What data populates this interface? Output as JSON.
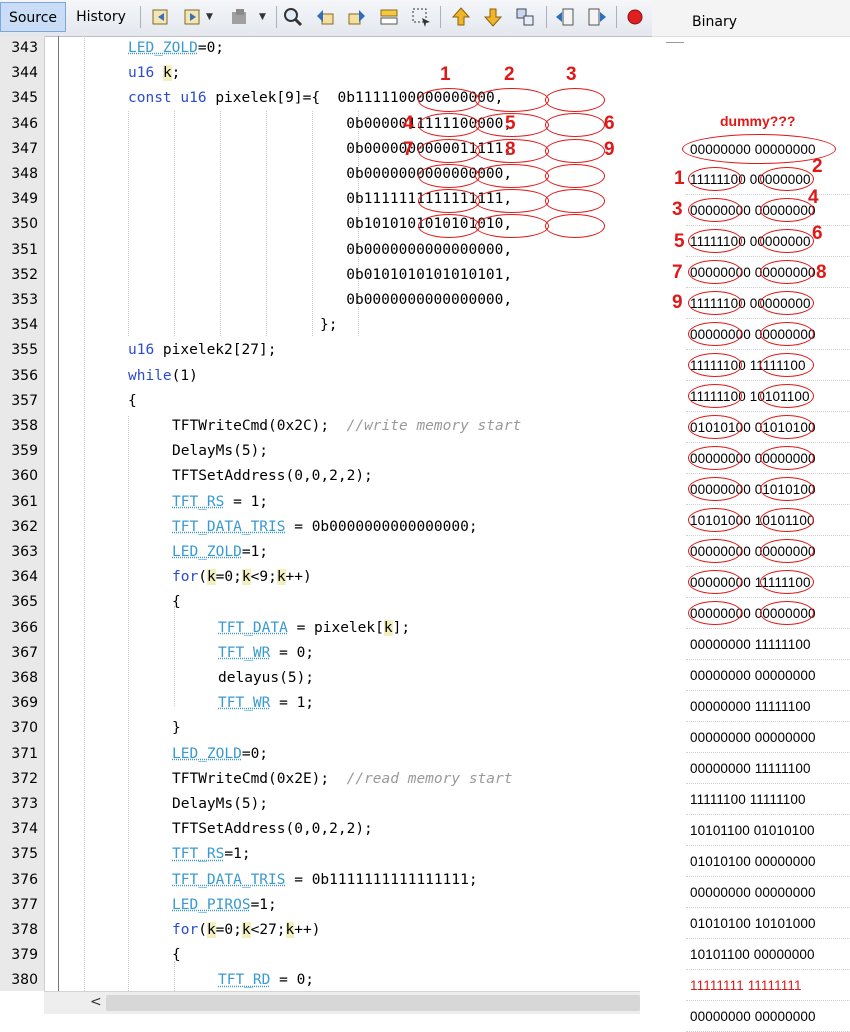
{
  "toolbar": {
    "tab_source": "Source",
    "tab_history": "History",
    "icons": [
      "back-icon",
      "forward-icon",
      "history-icon",
      "search-icon",
      "prev-occurrence-icon",
      "next-occurrence-icon",
      "toggle-highlight-icon",
      "select-icon",
      "bookmark-prev-icon",
      "bookmark-next-icon",
      "toggle-bookmark-icon",
      "shift-left-icon",
      "shift-right-icon",
      "record-macro-icon"
    ],
    "record_color": "#e02020"
  },
  "editor": {
    "lines": [
      {
        "num": "343",
        "text": "LED_ZOLD=0;"
      },
      {
        "num": "344",
        "text": "u16 k;"
      },
      {
        "num": "345",
        "text": "const u16 pixelek[9]={  0b1111100000000000,"
      },
      {
        "num": "346",
        "text": "                         0b0000011111100000,"
      },
      {
        "num": "347",
        "text": "                         0b0000000000011111,"
      },
      {
        "num": "348",
        "text": "                         0b0000000000000000,"
      },
      {
        "num": "349",
        "text": "                         0b1111111111111111,"
      },
      {
        "num": "350",
        "text": "                         0b1010101010101010,"
      },
      {
        "num": "351",
        "text": "                         0b0000000000000000,"
      },
      {
        "num": "352",
        "text": "                         0b0101010101010101,"
      },
      {
        "num": "353",
        "text": "                         0b0000000000000000,"
      },
      {
        "num": "354",
        "text": "                      };"
      },
      {
        "num": "355",
        "text": "u16 pixelek2[27];"
      },
      {
        "num": "356",
        "text": "while(1)"
      },
      {
        "num": "357",
        "text": "{"
      },
      {
        "num": "358",
        "text": "TFTWriteCmd(0x2C);  //write memory start"
      },
      {
        "num": "359",
        "text": "DelayMs(5);"
      },
      {
        "num": "360",
        "text": "TFTSetAddress(0,0,2,2);"
      },
      {
        "num": "361",
        "text": "TFT_RS = 1;"
      },
      {
        "num": "362",
        "text": "TFT_DATA_TRIS = 0b0000000000000000;"
      },
      {
        "num": "363",
        "text": "LED_ZOLD=1;"
      },
      {
        "num": "364",
        "text": "for(k=0;k<9;k++)"
      },
      {
        "num": "365",
        "text": "{"
      },
      {
        "num": "366",
        "text": "TFT_DATA = pixelek[k];"
      },
      {
        "num": "367",
        "text": "TFT_WR = 0;"
      },
      {
        "num": "368",
        "text": "delayus(5);"
      },
      {
        "num": "369",
        "text": "TFT_WR = 1;"
      },
      {
        "num": "370",
        "text": "}"
      },
      {
        "num": "371",
        "text": "LED_ZOLD=0;"
      },
      {
        "num": "372",
        "text": "TFTWriteCmd(0x2E);  //read memory start"
      },
      {
        "num": "373",
        "text": "DelayMs(5);"
      },
      {
        "num": "374",
        "text": "TFTSetAddress(0,0,2,2);"
      },
      {
        "num": "375",
        "text": "TFT_RS=1;"
      },
      {
        "num": "376",
        "text": "TFT_DATA_TRIS = 0b1111111111111111;"
      },
      {
        "num": "377",
        "text": "LED_PIROS=1;"
      },
      {
        "num": "378",
        "text": "for(k=0;k<27;k++)"
      },
      {
        "num": "379",
        "text": "{"
      },
      {
        "num": "380",
        "text": "TFT_RD = 0;"
      }
    ]
  },
  "binary_panel": {
    "header": "Binary",
    "dummy_label": "dummy???",
    "dummy_value": "00000000 00000000",
    "rows": [
      "11111100 00000000",
      "00000000 00000000",
      "11111100 00000000",
      "00000000 00000000",
      "11111100 00000000",
      "00000000 00000000",
      "11111100 11111100",
      "11111100 10101100",
      "01010100 01010100",
      "00000000 00000000",
      "00000000 01010100",
      "10101000 10101100",
      "00000000 00000000",
      "00000000 11111100",
      "00000000 00000000",
      "00000000 11111100",
      "00000000 00000000",
      "00000000 11111100",
      "00000000 00000000",
      "00000000 11111100",
      "11111100 11111100",
      "10101100 01010100",
      "01010100 00000000",
      "00000000 00000000",
      "01010100 10101000",
      "10101100 00000000",
      "11111111 11111111",
      "00000000 00000000"
    ],
    "highlight_color": "#e01818"
  },
  "annotations": {
    "code_col_numbers": [
      "1",
      "2",
      "3"
    ],
    "code_side_numbers": [
      "4",
      "5",
      "6",
      "7",
      "8",
      "9"
    ],
    "panel_numbers": [
      "1",
      "2",
      "3",
      "4",
      "5",
      "6",
      "7",
      "8",
      "9"
    ]
  }
}
